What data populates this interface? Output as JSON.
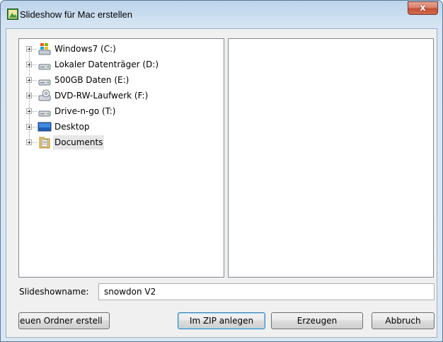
{
  "window": {
    "title": "Slideshow für Mac erstellen",
    "close_label": "x"
  },
  "tree": {
    "items": [
      {
        "label": "Windows7 (C:)",
        "icon": "windows-drive-icon"
      },
      {
        "label": "Lokaler Datenträger (D:)",
        "icon": "hard-drive-icon"
      },
      {
        "label": "500GB Daten (E:)",
        "icon": "hard-drive-icon"
      },
      {
        "label": "DVD-RW-Laufwerk (F:)",
        "icon": "dvd-drive-icon"
      },
      {
        "label": "Drive-n-go (T:)",
        "icon": "hard-drive-icon"
      },
      {
        "label": "Desktop",
        "icon": "desktop-icon"
      },
      {
        "label": "Documents",
        "icon": "documents-folder-icon",
        "selected": true
      }
    ]
  },
  "form": {
    "name_label": "Slideshowname:",
    "name_value": "snowdon V2"
  },
  "buttons": {
    "new_folder": "euen Ordner erstell",
    "zip": "Im ZIP anlegen",
    "create": "Erzeugen",
    "cancel": "Abbruch"
  }
}
